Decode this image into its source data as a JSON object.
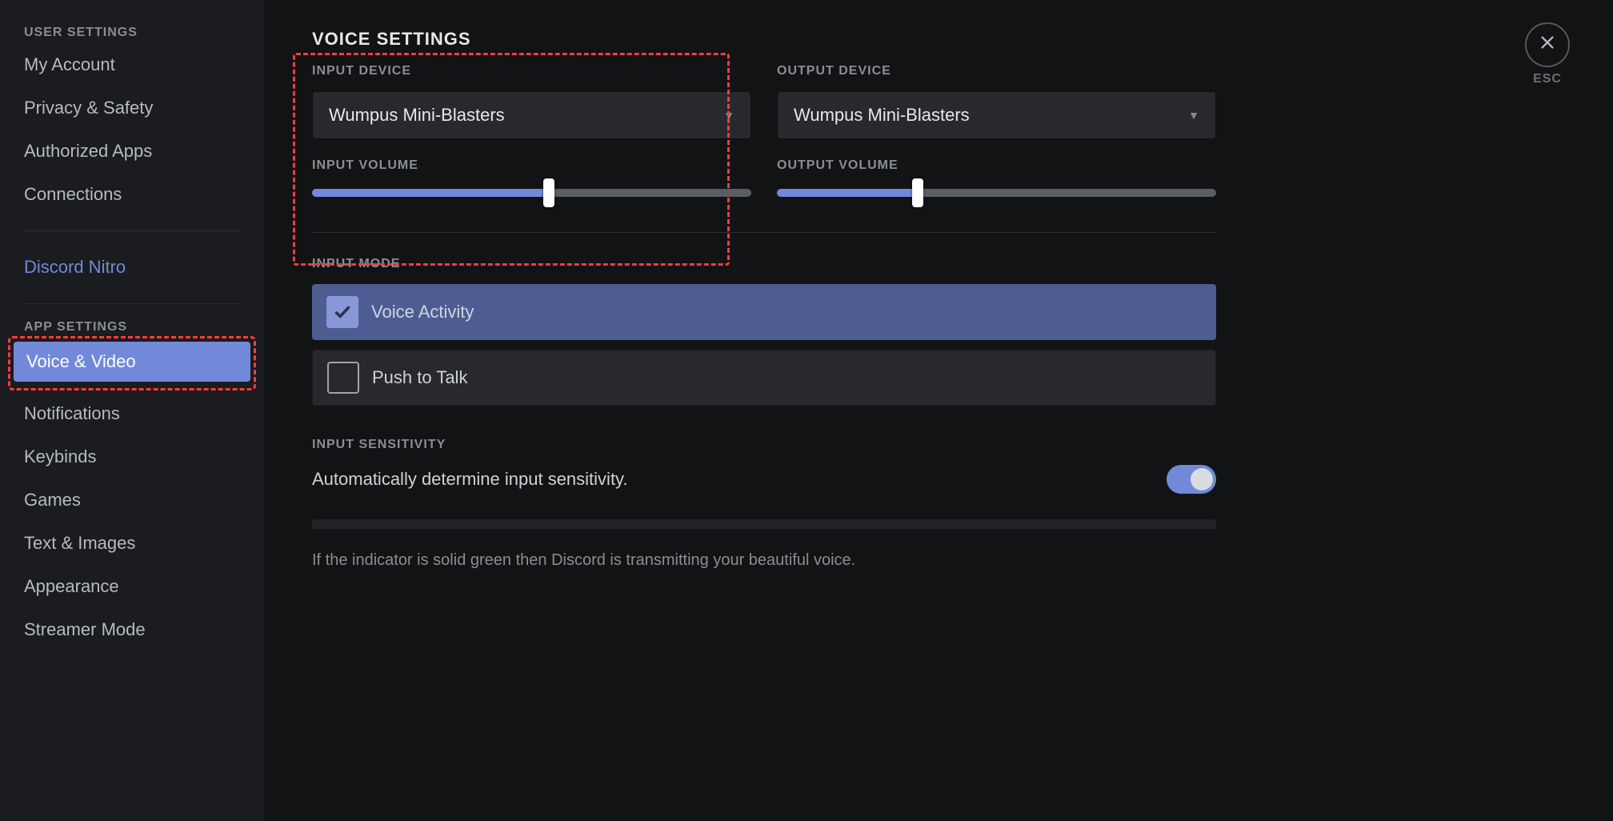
{
  "sidebar": {
    "user_header": "USER SETTINGS",
    "app_header": "APP SETTINGS",
    "user_items": [
      {
        "id": "my-account",
        "label": "My Account"
      },
      {
        "id": "privacy",
        "label": "Privacy & Safety"
      },
      {
        "id": "authorized",
        "label": "Authorized Apps"
      },
      {
        "id": "connections",
        "label": "Connections"
      }
    ],
    "nitro": {
      "label": "Discord Nitro"
    },
    "app_items": [
      {
        "id": "voice-video",
        "label": "Voice & Video"
      },
      {
        "id": "notifications",
        "label": "Notifications"
      },
      {
        "id": "keybinds",
        "label": "Keybinds"
      },
      {
        "id": "games",
        "label": "Games"
      },
      {
        "id": "text-images",
        "label": "Text & Images"
      },
      {
        "id": "appearance",
        "label": "Appearance"
      },
      {
        "id": "streamer",
        "label": "Streamer Mode"
      }
    ]
  },
  "close": {
    "esc_label": "ESC"
  },
  "voice": {
    "heading": "VOICE SETTINGS",
    "input_device_label": "INPUT DEVICE",
    "output_device_label": "OUTPUT DEVICE",
    "input_device_value": "Wumpus Mini-Blasters",
    "output_device_value": "Wumpus Mini-Blasters",
    "input_volume_label": "INPUT VOLUME",
    "output_volume_label": "OUTPUT VOLUME",
    "input_volume_pct": 54,
    "output_volume_pct": 32,
    "input_mode_label": "INPUT MODE",
    "mode_voice_activity": "Voice Activity",
    "mode_push_to_talk": "Push to Talk",
    "input_sensitivity_label": "INPUT SENSITIVITY",
    "auto_sens_desc": "Automatically determine input sensitivity.",
    "auto_sens_on": true,
    "hint": "If the indicator is solid green then Discord is transmitting your beautiful voice."
  },
  "colors": {
    "accent": "#7289da",
    "annotation": "#ff3b3b",
    "bg_dark": "#121315",
    "bg_sidebar": "#1a1c1f"
  }
}
